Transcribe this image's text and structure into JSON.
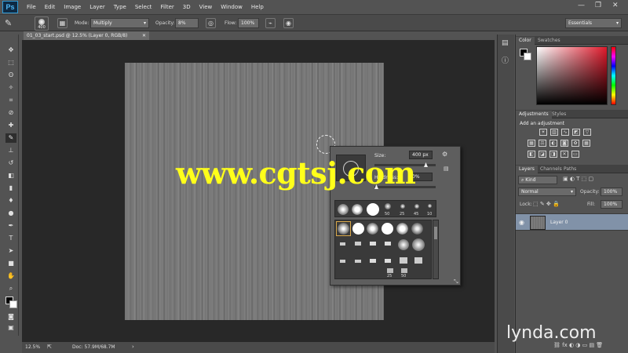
{
  "app": {
    "logo": "Ps"
  },
  "menu": [
    "File",
    "Edit",
    "Image",
    "Layer",
    "Type",
    "Select",
    "Filter",
    "3D",
    "View",
    "Window",
    "Help"
  ],
  "window_controls": {
    "minimize": "—",
    "maximize": "❐",
    "close": "✕"
  },
  "options": {
    "brush_size": "400",
    "mode_label": "Mode:",
    "mode_value": "Multiply",
    "opacity_label": "Opacity:",
    "opacity_value": "8%",
    "flow_label": "Flow:",
    "flow_value": "100%",
    "workspace": "Essentials"
  },
  "document": {
    "tab_title": "01_03_start.psd @ 12.5% (Layer 0, RGB/8)",
    "zoom": "12.5%",
    "doc_info": "Doc: 57.9M/68.7M"
  },
  "brush_picker": {
    "size_label": "Size:",
    "size_value": "400 px",
    "hardness_label": "Hardness:",
    "hardness_value": "0%",
    "recent_tips": [
      {
        "label": "",
        "kind": "soft"
      },
      {
        "label": "",
        "kind": "soft"
      },
      {
        "label": "",
        "kind": "hard"
      },
      {
        "label": "50",
        "kind": "soft"
      },
      {
        "label": "25",
        "kind": "soft"
      },
      {
        "label": "45",
        "kind": "soft"
      },
      {
        "label": "10",
        "kind": "soft"
      }
    ],
    "grid_numbers": [
      "25",
      "50"
    ]
  },
  "panels": {
    "color_tabs": [
      "Color",
      "Swatches"
    ],
    "adjust_tabs": [
      "Adjustments",
      "Styles"
    ],
    "add_adjustment": "Add an adjustment",
    "layers_tabs": [
      "Layers",
      "Channels",
      "Paths"
    ],
    "kind_label": "Kind",
    "blend_mode": "Normal",
    "opacity_label": "Opacity:",
    "opacity_value": "100%",
    "lock_label": "Lock:",
    "fill_label": "Fill:",
    "fill_value": "100%",
    "layer_name": "Layer 0"
  },
  "watermarks": {
    "cgtsj": "www.cgtsj.com",
    "lynda": "lynda.com"
  },
  "colors": {
    "bg": "#535353",
    "doc_bg": "#282828",
    "layer_selected": "#8192a8",
    "watermark": "#ffff1a"
  },
  "icons": [
    "brush-icon",
    "move-icon",
    "marquee-icon",
    "lasso-icon",
    "quick-select-icon",
    "crop-icon",
    "eyedropper-icon",
    "healing-icon",
    "stamp-icon",
    "history-brush-icon",
    "eraser-icon",
    "gradient-icon",
    "blur-icon",
    "dodge-icon",
    "pen-icon",
    "type-icon",
    "path-select-icon",
    "shape-icon",
    "hand-icon",
    "zoom-icon",
    "eye-icon",
    "gear-icon"
  ]
}
